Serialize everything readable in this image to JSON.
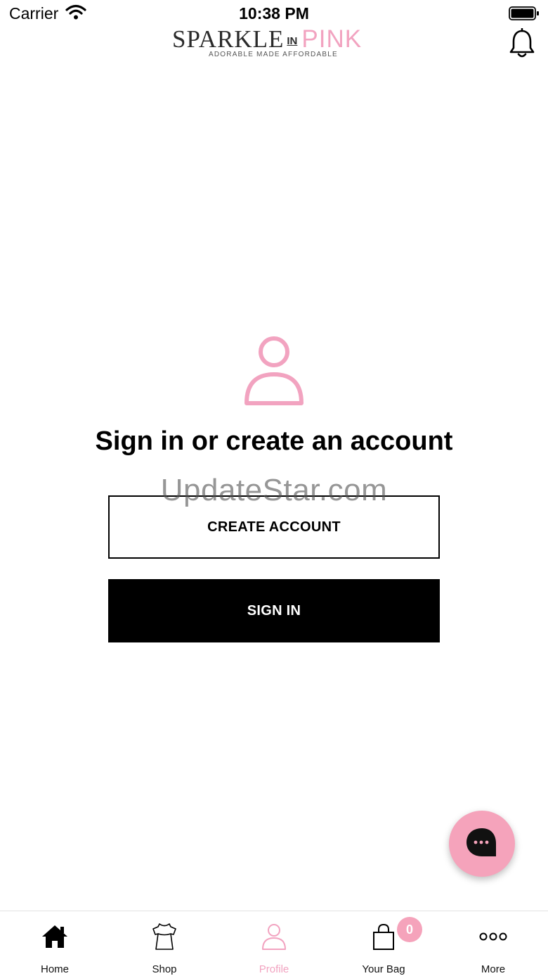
{
  "status_bar": {
    "carrier": "Carrier",
    "time": "10:38 PM",
    "icons": [
      "wifi-icon",
      "battery-icon"
    ]
  },
  "header": {
    "logo": {
      "sparkle": "SPARKLE",
      "in": "IN",
      "pink": "PINK",
      "tagline": "ADORABLE MADE AFFORDABLE"
    },
    "icons": [
      "bell-icon"
    ]
  },
  "main": {
    "icon": "profile-placeholder-icon",
    "title": "Sign in or create an account",
    "create_account_label": "CREATE ACCOUNT",
    "sign_in_label": "SIGN IN"
  },
  "watermark": "UpdateStar.com",
  "chat_fab": {
    "icon": "chat-bubble-icon"
  },
  "tab_bar": {
    "tabs": [
      {
        "label": "Home",
        "icon": "home-icon",
        "active": false
      },
      {
        "label": "Shop",
        "icon": "dress-icon",
        "active": false
      },
      {
        "label": "Profile",
        "icon": "profile-icon",
        "active": true
      },
      {
        "label": "Your Bag",
        "icon": "bag-icon",
        "active": false,
        "badge": "0"
      },
      {
        "label": "More",
        "icon": "more-dots-icon",
        "active": false
      }
    ]
  },
  "colors": {
    "accent_pink": "#f2a3c0",
    "fab_pink": "#f5a3bb",
    "primary": "#000000",
    "background": "#ffffff"
  }
}
